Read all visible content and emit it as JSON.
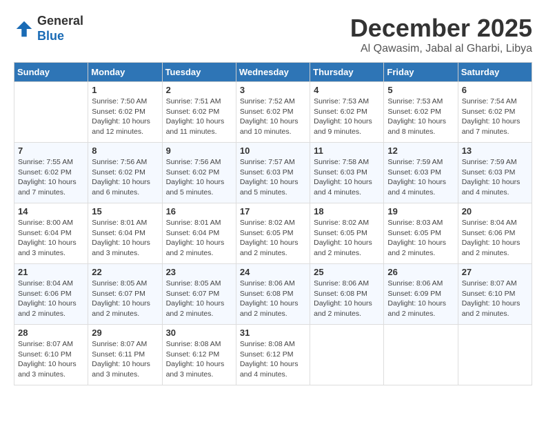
{
  "header": {
    "logo_line1": "General",
    "logo_line2": "Blue",
    "month_title": "December 2025",
    "subtitle": "Al Qawasim, Jabal al Gharbi, Libya"
  },
  "days_of_week": [
    "Sunday",
    "Monday",
    "Tuesday",
    "Wednesday",
    "Thursday",
    "Friday",
    "Saturday"
  ],
  "weeks": [
    [
      {
        "day": "",
        "info": ""
      },
      {
        "day": "1",
        "info": "Sunrise: 7:50 AM\nSunset: 6:02 PM\nDaylight: 10 hours\nand 12 minutes."
      },
      {
        "day": "2",
        "info": "Sunrise: 7:51 AM\nSunset: 6:02 PM\nDaylight: 10 hours\nand 11 minutes."
      },
      {
        "day": "3",
        "info": "Sunrise: 7:52 AM\nSunset: 6:02 PM\nDaylight: 10 hours\nand 10 minutes."
      },
      {
        "day": "4",
        "info": "Sunrise: 7:53 AM\nSunset: 6:02 PM\nDaylight: 10 hours\nand 9 minutes."
      },
      {
        "day": "5",
        "info": "Sunrise: 7:53 AM\nSunset: 6:02 PM\nDaylight: 10 hours\nand 8 minutes."
      },
      {
        "day": "6",
        "info": "Sunrise: 7:54 AM\nSunset: 6:02 PM\nDaylight: 10 hours\nand 7 minutes."
      }
    ],
    [
      {
        "day": "7",
        "info": "Sunrise: 7:55 AM\nSunset: 6:02 PM\nDaylight: 10 hours\nand 7 minutes."
      },
      {
        "day": "8",
        "info": "Sunrise: 7:56 AM\nSunset: 6:02 PM\nDaylight: 10 hours\nand 6 minutes."
      },
      {
        "day": "9",
        "info": "Sunrise: 7:56 AM\nSunset: 6:02 PM\nDaylight: 10 hours\nand 5 minutes."
      },
      {
        "day": "10",
        "info": "Sunrise: 7:57 AM\nSunset: 6:03 PM\nDaylight: 10 hours\nand 5 minutes."
      },
      {
        "day": "11",
        "info": "Sunrise: 7:58 AM\nSunset: 6:03 PM\nDaylight: 10 hours\nand 4 minutes."
      },
      {
        "day": "12",
        "info": "Sunrise: 7:59 AM\nSunset: 6:03 PM\nDaylight: 10 hours\nand 4 minutes."
      },
      {
        "day": "13",
        "info": "Sunrise: 7:59 AM\nSunset: 6:03 PM\nDaylight: 10 hours\nand 4 minutes."
      }
    ],
    [
      {
        "day": "14",
        "info": "Sunrise: 8:00 AM\nSunset: 6:04 PM\nDaylight: 10 hours\nand 3 minutes."
      },
      {
        "day": "15",
        "info": "Sunrise: 8:01 AM\nSunset: 6:04 PM\nDaylight: 10 hours\nand 3 minutes."
      },
      {
        "day": "16",
        "info": "Sunrise: 8:01 AM\nSunset: 6:04 PM\nDaylight: 10 hours\nand 2 minutes."
      },
      {
        "day": "17",
        "info": "Sunrise: 8:02 AM\nSunset: 6:05 PM\nDaylight: 10 hours\nand 2 minutes."
      },
      {
        "day": "18",
        "info": "Sunrise: 8:02 AM\nSunset: 6:05 PM\nDaylight: 10 hours\nand 2 minutes."
      },
      {
        "day": "19",
        "info": "Sunrise: 8:03 AM\nSunset: 6:05 PM\nDaylight: 10 hours\nand 2 minutes."
      },
      {
        "day": "20",
        "info": "Sunrise: 8:04 AM\nSunset: 6:06 PM\nDaylight: 10 hours\nand 2 minutes."
      }
    ],
    [
      {
        "day": "21",
        "info": "Sunrise: 8:04 AM\nSunset: 6:06 PM\nDaylight: 10 hours\nand 2 minutes."
      },
      {
        "day": "22",
        "info": "Sunrise: 8:05 AM\nSunset: 6:07 PM\nDaylight: 10 hours\nand 2 minutes."
      },
      {
        "day": "23",
        "info": "Sunrise: 8:05 AM\nSunset: 6:07 PM\nDaylight: 10 hours\nand 2 minutes."
      },
      {
        "day": "24",
        "info": "Sunrise: 8:06 AM\nSunset: 6:08 PM\nDaylight: 10 hours\nand 2 minutes."
      },
      {
        "day": "25",
        "info": "Sunrise: 8:06 AM\nSunset: 6:08 PM\nDaylight: 10 hours\nand 2 minutes."
      },
      {
        "day": "26",
        "info": "Sunrise: 8:06 AM\nSunset: 6:09 PM\nDaylight: 10 hours\nand 2 minutes."
      },
      {
        "day": "27",
        "info": "Sunrise: 8:07 AM\nSunset: 6:10 PM\nDaylight: 10 hours\nand 2 minutes."
      }
    ],
    [
      {
        "day": "28",
        "info": "Sunrise: 8:07 AM\nSunset: 6:10 PM\nDaylight: 10 hours\nand 3 minutes."
      },
      {
        "day": "29",
        "info": "Sunrise: 8:07 AM\nSunset: 6:11 PM\nDaylight: 10 hours\nand 3 minutes."
      },
      {
        "day": "30",
        "info": "Sunrise: 8:08 AM\nSunset: 6:12 PM\nDaylight: 10 hours\nand 3 minutes."
      },
      {
        "day": "31",
        "info": "Sunrise: 8:08 AM\nSunset: 6:12 PM\nDaylight: 10 hours\nand 4 minutes."
      },
      {
        "day": "",
        "info": ""
      },
      {
        "day": "",
        "info": ""
      },
      {
        "day": "",
        "info": ""
      }
    ]
  ]
}
